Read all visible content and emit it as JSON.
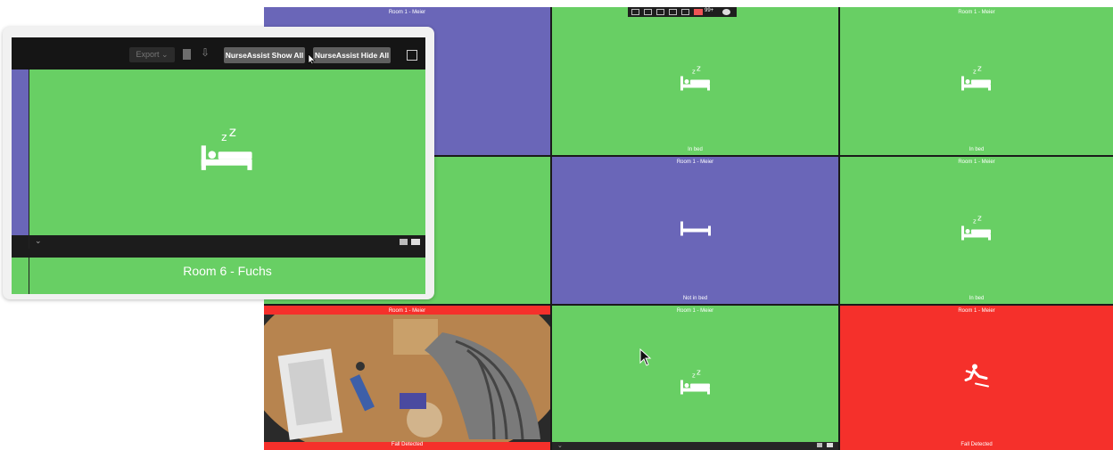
{
  "tiles": {
    "t1": {
      "title": "Room 1 - Meier",
      "status": ""
    },
    "t2": {
      "title": "",
      "status": "In bed"
    },
    "t3": {
      "title": "Room 1 - Meier",
      "status": "In bed"
    },
    "t5": {
      "title": "Room 1 - Meier",
      "status": "Not in bed"
    },
    "t6": {
      "title": "Room 1 - Meier",
      "status": "In bed"
    },
    "t7": {
      "title": "Room 1 - Meier",
      "status": "Fall Detected"
    },
    "t8": {
      "title": "Room 1 - Meier",
      "status": ""
    },
    "t9": {
      "title": "Room 1 - Meier",
      "status": "Fall Detected"
    }
  },
  "topbar": {
    "count": "99+"
  },
  "zoom": {
    "export_label": "Export",
    "show_all_label": "NurseAssist Show All",
    "hide_all_label": "NurseAssist Hide All",
    "room_label": "Room 6 - Fuchs"
  },
  "colors": {
    "green": "#68cf64",
    "purple": "#6a66b8",
    "red": "#f5302b"
  }
}
